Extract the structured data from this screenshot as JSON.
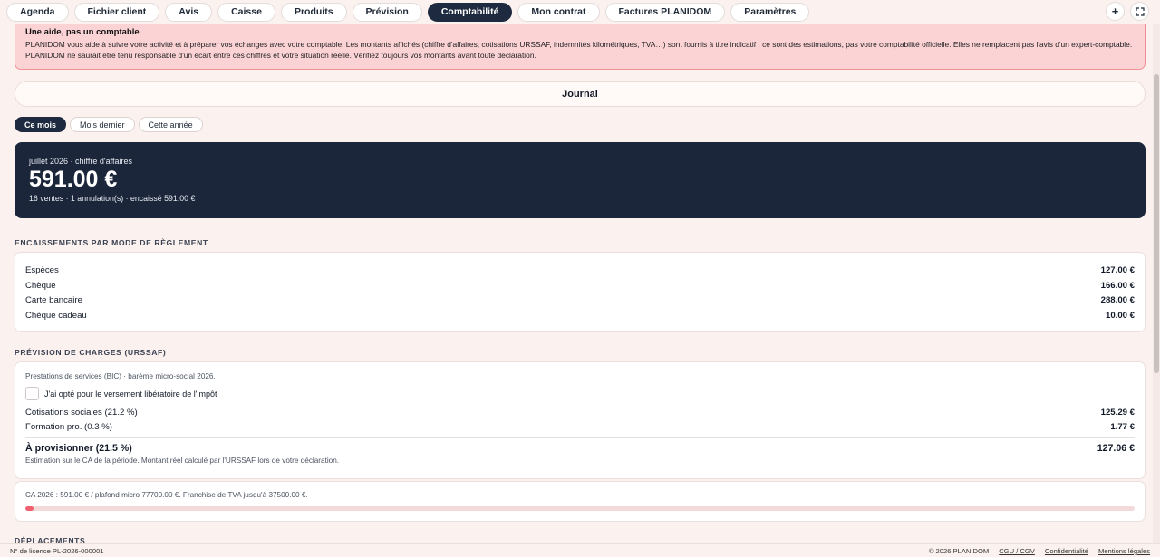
{
  "nav": {
    "tabs": [
      {
        "label": "Agenda"
      },
      {
        "label": "Fichier client"
      },
      {
        "label": "Avis"
      },
      {
        "label": "Caisse"
      },
      {
        "label": "Produits"
      },
      {
        "label": "Prévision"
      },
      {
        "label": "Comptabilité",
        "active": true
      },
      {
        "label": "Mon contrat"
      },
      {
        "label": "Factures PLANIDOM"
      },
      {
        "label": "Paramètres"
      }
    ],
    "add_icon": "+",
    "expand_icon": "⛶"
  },
  "disclaimer": {
    "title": "Une aide, pas un comptable",
    "body": "PLANIDOM vous aide à suivre votre activité et à préparer vos échanges avec votre comptable. Les montants affichés (chiffre d'affaires, cotisations URSSAF, indemnités kilométriques, TVA…) sont fournis à titre indicatif : ce sont des estimations, pas votre comptabilité officielle. Elles ne remplacent pas l'avis d'un expert-comptable. PLANIDOM ne saurait être tenu responsable d'un écart entre ces chiffres et votre situation réelle. Vérifiez toujours vos montants avant toute déclaration."
  },
  "journal": {
    "label": "Journal"
  },
  "periods": [
    "Ce mois",
    "Mois dernier",
    "Cette année"
  ],
  "summary": {
    "label": "juillet 2026 · chiffre d'affaires",
    "amount": "591.00 €",
    "sub": "16 ventes · 1 annulation(s) · encaissé 591.00 €"
  },
  "payments": {
    "title": "ENCAISSEMENTS PAR MODE DE RÈGLEMENT",
    "rows": [
      {
        "label": "Espèces",
        "value": "127.00 €"
      },
      {
        "label": "Chèque",
        "value": "166.00 €"
      },
      {
        "label": "Carte bancaire",
        "value": "288.00 €"
      },
      {
        "label": "Chèque cadeau",
        "value": "10.00 €"
      }
    ]
  },
  "urssaf": {
    "title": "PRÉVISION DE CHARGES (URSSAF)",
    "scheme": "Prestations de services (BIC) · barème micro-social 2026.",
    "checkbox_label": "J'ai opté pour le versement libératoire de l'impôt",
    "checked": false,
    "rows": [
      {
        "label": "Cotisations sociales (21.2 %)",
        "value": "125.29 €"
      },
      {
        "label": "Formation pro. (0.3 %)",
        "value": "1.77 €"
      }
    ],
    "total_label": "À provisionner (21.5 %)",
    "total_value": "127.06 €",
    "note": "Estimation sur le CA de la période. Montant réel calculé par l'URSSAF lors de votre déclaration."
  },
  "plafond": {
    "text": "CA 2026 : 591.00 € / plafond micro 77700.00 €. Franchise de TVA jusqu'à 37500.00 €.",
    "progress_fraction": 0.0076,
    "fill_color": "#ef5f6d"
  },
  "next_section": {
    "title": "DÉPLACEMENTS"
  },
  "footer": {
    "license": "N° de licence PL-2026-000001",
    "copyright": "© 2026 PLANIDOM",
    "links": [
      "CGU / CGV",
      "Confidentialité",
      "Mentions légales"
    ]
  }
}
